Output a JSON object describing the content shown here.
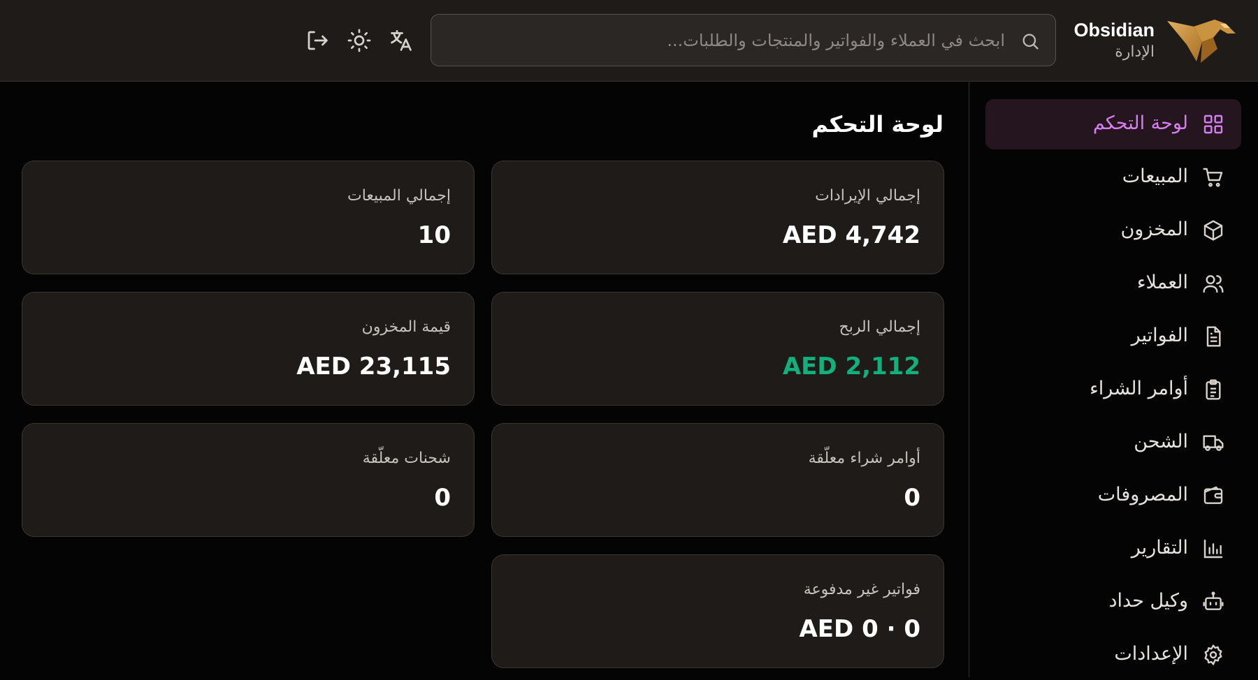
{
  "header": {
    "brand_name": "Obsidian",
    "brand_subtitle": "الإدارة",
    "search_placeholder": "ابحث في العملاء والفواتير والمنتجات والطلبات..."
  },
  "colors": {
    "accent": "#d67ff0",
    "active_nav_bg": "#25151f",
    "profit": "#12b07c",
    "logo_gold": "#c9933f"
  },
  "sidebar": {
    "items": [
      {
        "label": "لوحة التحكم",
        "icon": "dashboard-icon",
        "active": true
      },
      {
        "label": "المبيعات",
        "icon": "cart-icon"
      },
      {
        "label": "المخزون",
        "icon": "box-icon"
      },
      {
        "label": "العملاء",
        "icon": "users-icon"
      },
      {
        "label": "الفواتير",
        "icon": "document-icon"
      },
      {
        "label": "أوامر الشراء",
        "icon": "clipboard-icon"
      },
      {
        "label": "الشحن",
        "icon": "truck-icon"
      },
      {
        "label": "المصروفات",
        "icon": "wallet-icon"
      },
      {
        "label": "التقارير",
        "icon": "bar-chart-icon"
      },
      {
        "label": "وكيل حداد",
        "icon": "bot-icon"
      },
      {
        "label": "الإعدادات",
        "icon": "settings-icon"
      }
    ]
  },
  "main": {
    "title": "لوحة التحكم",
    "cards": {
      "total_revenue": {
        "label": "إجمالي الإيرادات",
        "value": "AED 4,742"
      },
      "total_sales": {
        "label": "إجمالي المبيعات",
        "value": "10"
      },
      "total_profit": {
        "label": "إجمالي الربح",
        "value": "AED 2,112"
      },
      "inventory_value": {
        "label": "قيمة المخزون",
        "value": "AED 23,115"
      },
      "pending_purchase_orders": {
        "label": "أوامر شراء معلّقة",
        "value": "0"
      },
      "pending_shipments": {
        "label": "شحنات معلّقة",
        "value": "0"
      },
      "unpaid_invoices": {
        "label": "فواتير غير مدفوعة",
        "value": "AED 0 · 0"
      }
    }
  }
}
